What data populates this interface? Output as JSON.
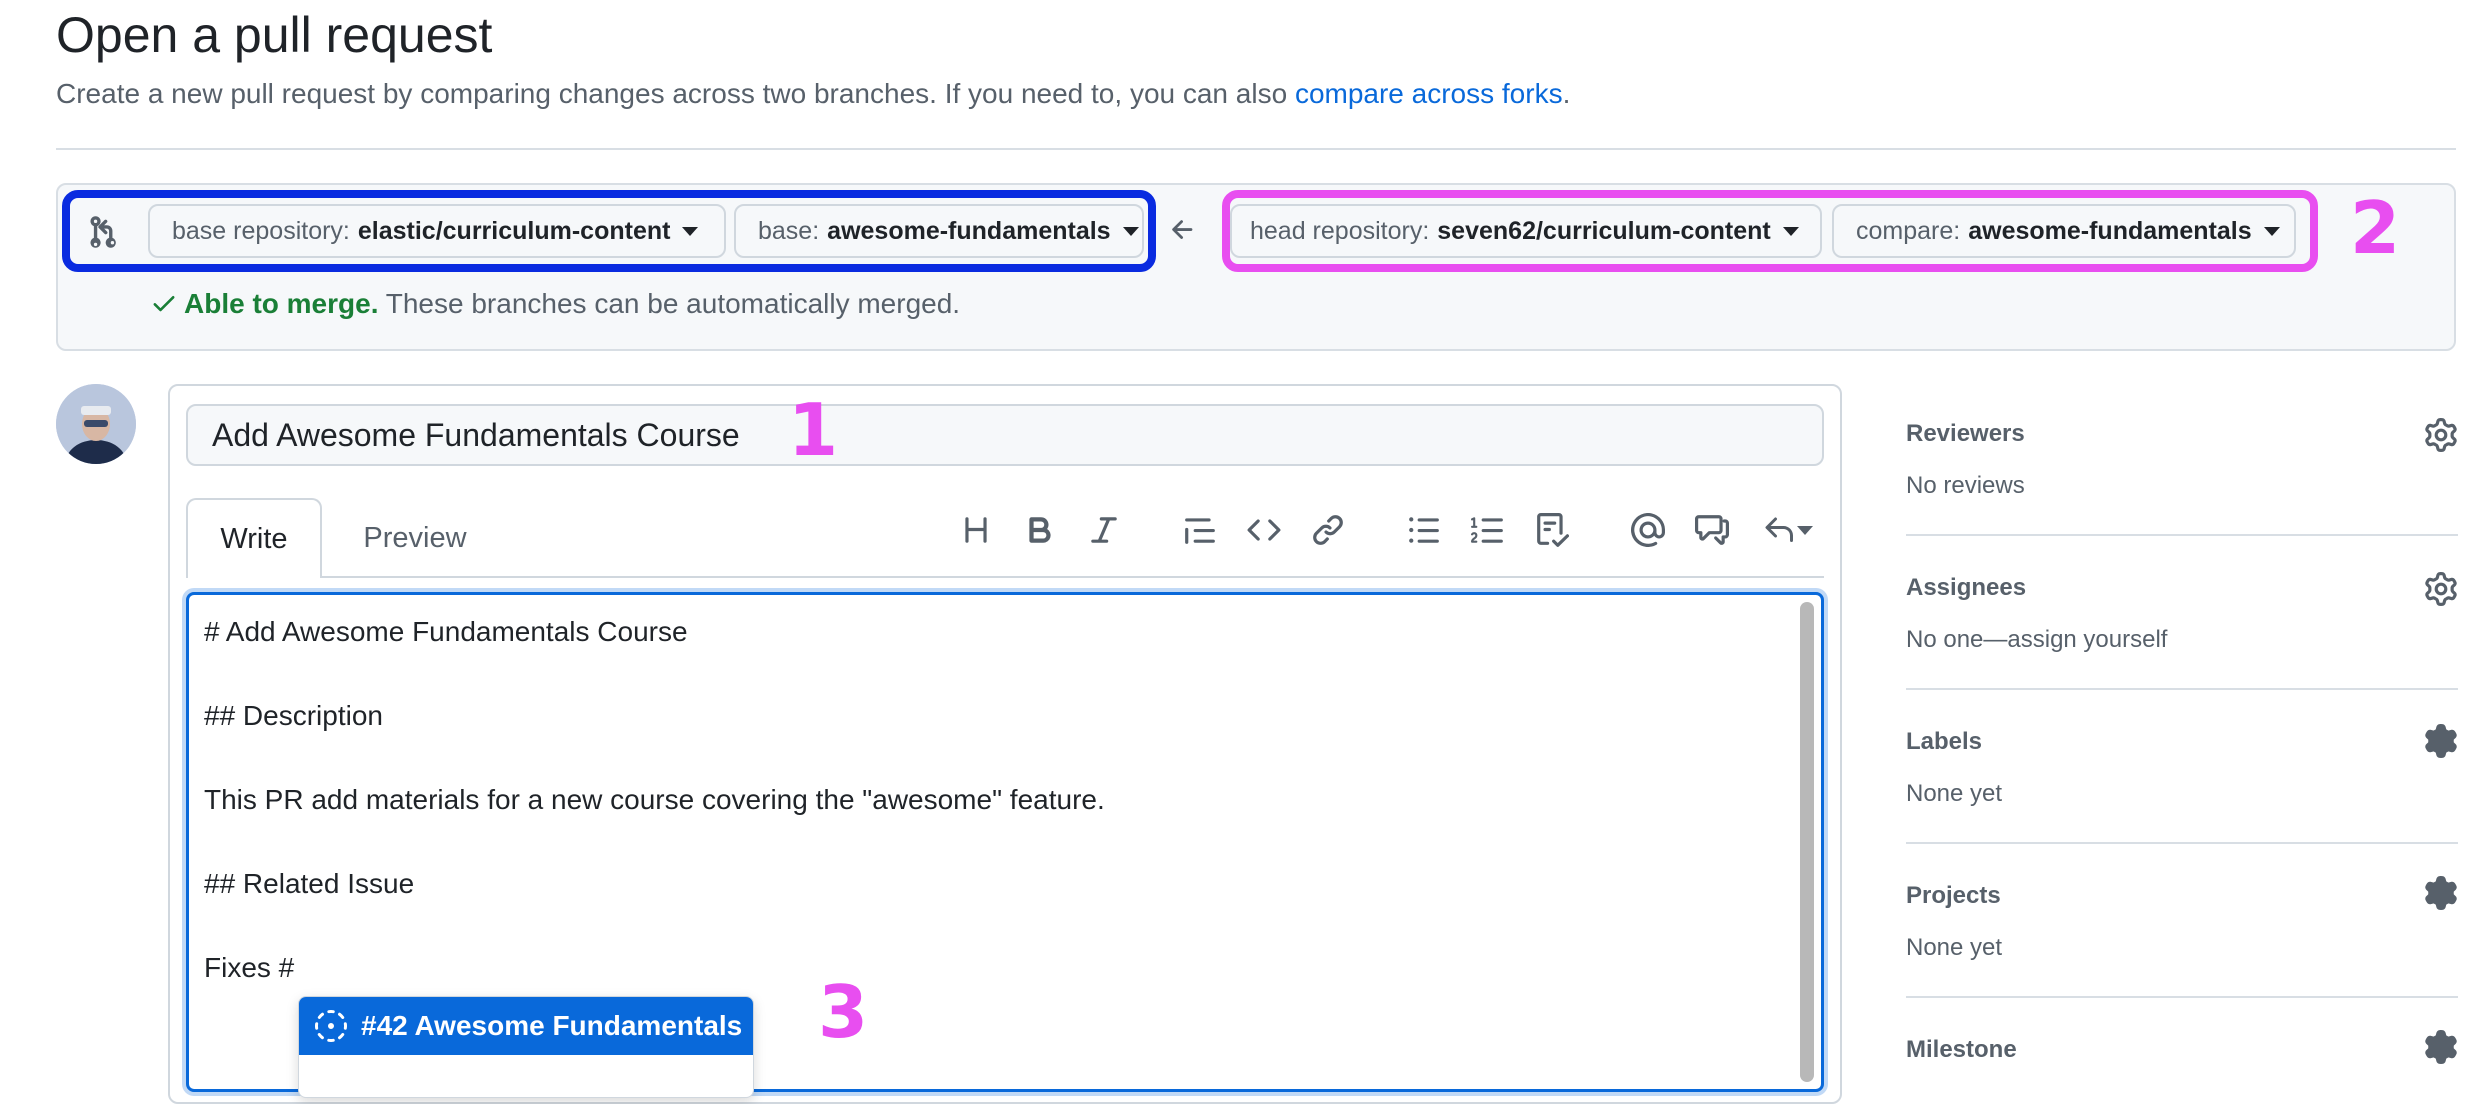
{
  "page": {
    "title": "Open a pull request",
    "subtitle_text": "Create a new pull request by comparing changes across two branches. If you need to, you can also ",
    "subtitle_link": "compare across forks",
    "subtitle_end": "."
  },
  "range": {
    "base_repo_label": "base repository:",
    "base_repo_value": "elastic/curriculum-content",
    "base_label": "base:",
    "base_value": "awesome-fundamentals",
    "head_repo_label": "head repository:",
    "head_repo_value": "seven62/curriculum-content",
    "compare_label": "compare:",
    "compare_value": "awesome-fundamentals",
    "merge_ok": "Able to merge.",
    "merge_text": " These branches can be automatically merged."
  },
  "annotations": {
    "one": "1",
    "two": "2",
    "three": "3"
  },
  "annotation_colors": {
    "base": "#0a2be0",
    "head": "#e84ef0"
  },
  "form": {
    "title_value": "Add Awesome Fundamentals Course",
    "tab_write": "Write",
    "tab_preview": "Preview",
    "toolbar_icons": [
      "heading-icon",
      "bold-icon",
      "italic-icon",
      "quote-icon",
      "code-icon",
      "link-icon",
      "unordered-list-icon",
      "ordered-list-icon",
      "task-list-icon",
      "mention-icon",
      "cross-reference-icon",
      "saved-replies-icon"
    ],
    "body_lines": [
      "# Add Awesome Fundamentals Course",
      "## Description",
      "This PR add materials for a new course covering the \"awesome\" feature.",
      "## Related Issue",
      "Fixes #"
    ],
    "suggestion": "#42 Awesome Fundamentals"
  },
  "sidebar": {
    "reviewers": {
      "head": "Reviewers",
      "value": "No reviews"
    },
    "assignees": {
      "head": "Assignees",
      "value": "No one—assign yourself"
    },
    "labels": {
      "head": "Labels",
      "value": "None yet"
    },
    "projects": {
      "head": "Projects",
      "value": "None yet"
    },
    "milestone": {
      "head": "Milestone"
    }
  }
}
